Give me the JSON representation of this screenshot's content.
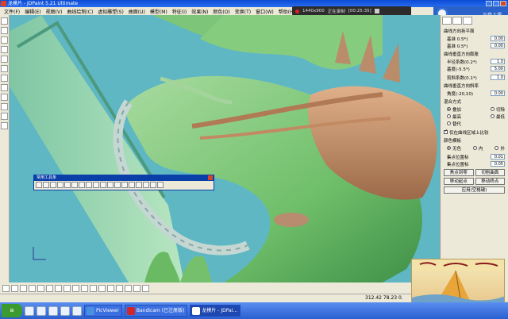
{
  "app": {
    "title": "龙模片 - JDPaint 5.21 Ultimate"
  },
  "menu": [
    "文件(F)",
    "编辑(E)",
    "视图(V)",
    "曲线绘制(C)",
    "虚拟雕塑(S)",
    "曲面(U)",
    "模型(M)",
    "特征(I)",
    "效果(N)",
    "颜色(O)",
    "变换(T)",
    "窗口(W)",
    "帮助(H)"
  ],
  "recorder": {
    "resolution": "1440x900",
    "status": "正在录制",
    "time": "[00:25:35]"
  },
  "corner_badge": "与我上课",
  "floating_toolbar": {
    "title": "常用工具条"
  },
  "right_panel": {
    "group1": {
      "title": "曲线方向拆平面",
      "rows": [
        {
          "label": "基准 0.5*)",
          "value": "0.00"
        },
        {
          "label": "基准 0.5*)",
          "value": "0.00"
        }
      ]
    },
    "group2": {
      "title": "曲线垂直方向膨胀",
      "rows": [
        {
          "label": "半径系数(0.2*)",
          "value": "1.0"
        },
        {
          "label": "基度(-5.5*)",
          "value": "5.00"
        }
      ]
    },
    "group3": {
      "rows": [
        {
          "label": "剪斜系数(0.1*)",
          "value": "1.0"
        }
      ]
    },
    "group4": {
      "title": "曲线垂直方向斜率",
      "rows": [
        {
          "label": "角度(-20,10)",
          "value": "0.00"
        }
      ]
    },
    "mix_mode": {
      "title": "混合方式",
      "options": [
        "叠加",
        "切除",
        "最高",
        "最低",
        "替代"
      ]
    },
    "checkbox_label": "仅在曲线区域上比较",
    "color_mask": {
      "title": "颜色模板",
      "options": [
        "无色",
        "内",
        "外"
      ]
    },
    "pos_rows": [
      {
        "label": "集点位置标",
        "value": "0.01"
      },
      {
        "label": "集点位置标",
        "value": "0.05"
      }
    ],
    "buttons": [
      "焦点到零",
      "切削曲面",
      "移动起点",
      "移动终点"
    ],
    "apply_button": "应用(空格键)"
  },
  "status": {
    "coords": "312.42 78.23 0."
  },
  "taskbar": {
    "tasks": [
      {
        "label": "PicViewer",
        "active": false
      },
      {
        "label": "Bandicam (已注册版)",
        "active": false
      },
      {
        "label": "龙模片 - JDPai...",
        "active": true
      }
    ]
  },
  "colors": {
    "title_bar": "#0a4bd4",
    "model_green": "#7fc97a",
    "model_teal_bg": "#5fb7c4",
    "model_copper": "#c49068",
    "taskbar": "#2a5fd0"
  }
}
